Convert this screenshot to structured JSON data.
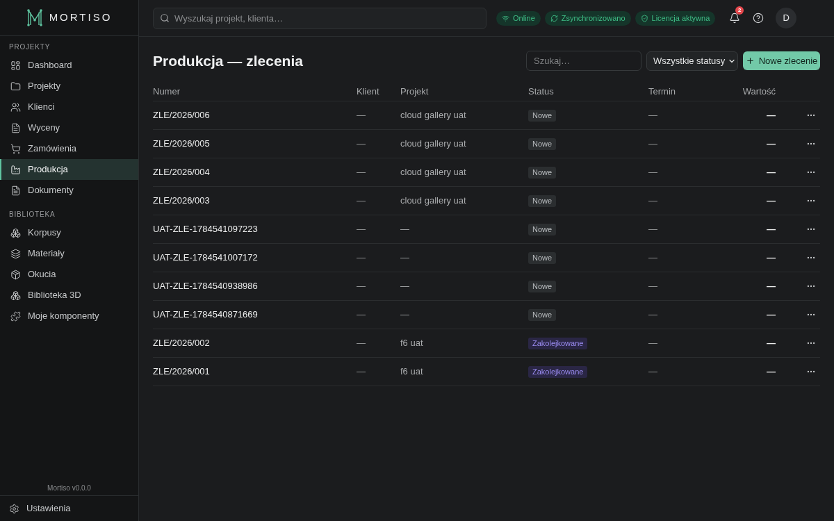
{
  "sidebar": {
    "logo": {
      "text": "MORTISO"
    },
    "sections": [
      {
        "title": "PROJEKTY",
        "items": [
          {
            "label": "Dashboard",
            "selected": false
          },
          {
            "label": "Projekty",
            "selected": false
          },
          {
            "label": "Klienci",
            "selected": false
          },
          {
            "label": "Wyceny",
            "selected": false
          },
          {
            "label": "Zamówienia",
            "selected": false
          },
          {
            "label": "Produkcja",
            "selected": true
          },
          {
            "label": "Dokumenty",
            "selected": false
          }
        ]
      },
      {
        "title": "BIBLIOTEKA",
        "items": [
          {
            "label": "Korpusy",
            "selected": false
          },
          {
            "label": "Materiały",
            "selected": false
          },
          {
            "label": "Okucia",
            "selected": false
          },
          {
            "label": "Biblioteka 3D",
            "selected": false
          },
          {
            "label": "Moje komponenty",
            "selected": false
          }
        ]
      }
    ],
    "version": "Mortiso v0.0.0",
    "settings": {
      "label": "Ustawienia"
    }
  },
  "top_bar": {
    "search": {
      "placeholder": "Wyszukaj projekt, klienta…"
    },
    "status_badges": [
      {
        "label": "Online"
      },
      {
        "label": "Zsynchronizowano"
      },
      {
        "label": "Licencja aktywna"
      }
    ],
    "notifications": {
      "count": "2"
    },
    "avatar": {
      "initial": "D"
    }
  },
  "page": {
    "title": "Produkcja — zlecenia",
    "search": {
      "placeholder": "Szukaj…"
    },
    "status_filter": {
      "value": "Wszystkie statusy"
    },
    "new_button": {
      "label": "Nowe zlecenie"
    }
  },
  "table": {
    "columns": [
      "Numer",
      "Klient",
      "Projekt",
      "Status",
      "Termin",
      "Wartość"
    ],
    "rows": [
      {
        "number": "ZLE/2026/006",
        "client": "—",
        "project": "cloud gallery uat",
        "status": {
          "label": "Nowe",
          "kind": "new"
        },
        "deadline": "—",
        "value": "—"
      },
      {
        "number": "ZLE/2026/005",
        "client": "—",
        "project": "cloud gallery uat",
        "status": {
          "label": "Nowe",
          "kind": "new"
        },
        "deadline": "—",
        "value": "—"
      },
      {
        "number": "ZLE/2026/004",
        "client": "—",
        "project": "cloud gallery uat",
        "status": {
          "label": "Nowe",
          "kind": "new"
        },
        "deadline": "—",
        "value": "—"
      },
      {
        "number": "ZLE/2026/003",
        "client": "—",
        "project": "cloud gallery uat",
        "status": {
          "label": "Nowe",
          "kind": "new"
        },
        "deadline": "—",
        "value": "—"
      },
      {
        "number": "UAT-ZLE-1784541097223",
        "client": "—",
        "project": "—",
        "status": {
          "label": "Nowe",
          "kind": "new"
        },
        "deadline": "—",
        "value": "—"
      },
      {
        "number": "UAT-ZLE-1784541007172",
        "client": "—",
        "project": "—",
        "status": {
          "label": "Nowe",
          "kind": "new"
        },
        "deadline": "—",
        "value": "—"
      },
      {
        "number": "UAT-ZLE-1784540938986",
        "client": "—",
        "project": "—",
        "status": {
          "label": "Nowe",
          "kind": "new"
        },
        "deadline": "—",
        "value": "—"
      },
      {
        "number": "UAT-ZLE-1784540871669",
        "client": "—",
        "project": "—",
        "status": {
          "label": "Nowe",
          "kind": "new"
        },
        "deadline": "—",
        "value": "—"
      },
      {
        "number": "ZLE/2026/002",
        "client": "—",
        "project": "f6 uat",
        "status": {
          "label": "Zakolejkowane",
          "kind": "queued"
        },
        "deadline": "—",
        "value": "—"
      },
      {
        "number": "ZLE/2026/001",
        "client": "—",
        "project": "f6 uat",
        "status": {
          "label": "Zakolejkowane",
          "kind": "queued"
        },
        "deadline": "—",
        "value": "—"
      }
    ]
  }
}
